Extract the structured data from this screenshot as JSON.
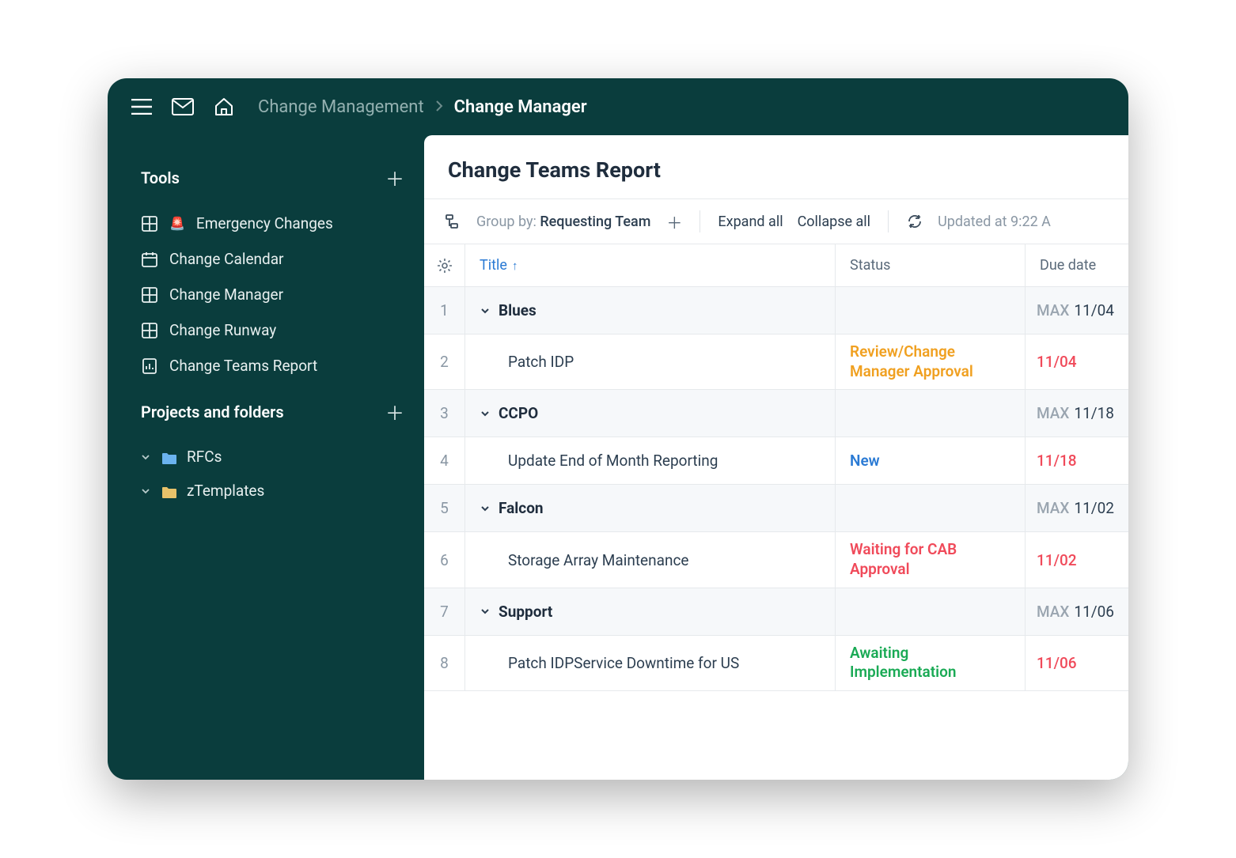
{
  "breadcrumb": {
    "parent": "Change Management",
    "current": "Change Manager"
  },
  "sidebar": {
    "sections": [
      {
        "title": "Tools",
        "items": [
          {
            "icon": "grid",
            "label": "Emergency Changes",
            "emoji": "🚨"
          },
          {
            "icon": "calendar",
            "label": "Change Calendar"
          },
          {
            "icon": "grid",
            "label": "Change Manager"
          },
          {
            "icon": "grid",
            "label": "Change Runway"
          },
          {
            "icon": "report",
            "label": "Change Teams Report"
          }
        ]
      },
      {
        "title": "Projects and folders",
        "folders": [
          {
            "label": "RFCs",
            "color": "#6bb3ef"
          },
          {
            "label": "zTemplates",
            "color": "#e8c26a"
          }
        ]
      }
    ]
  },
  "main": {
    "title": "Change Teams Report",
    "toolbar": {
      "groupby_label": "Group by:",
      "groupby_value": "Requesting Team",
      "expand": "Expand all",
      "collapse": "Collapse all",
      "updated_prefix": "Updated at",
      "updated_time": "9:22 A"
    },
    "columns": {
      "title": "Title",
      "status": "Status",
      "due": "Due date"
    },
    "rows": [
      {
        "num": 1,
        "type": "group",
        "title": "Blues",
        "due_prefix": "MAX",
        "due": "11/04"
      },
      {
        "num": 2,
        "type": "item",
        "title": "Patch IDP",
        "status": "Review/Change Manager Approval",
        "status_color": "#f0a020",
        "due": "11/04",
        "due_red": true
      },
      {
        "num": 3,
        "type": "group",
        "title": "CCPO",
        "due_prefix": "MAX",
        "due": "11/18"
      },
      {
        "num": 4,
        "type": "item",
        "title": "Update End of Month Reporting",
        "status": "New",
        "status_color": "#2a7ad4",
        "due": "11/18",
        "due_red": true
      },
      {
        "num": 5,
        "type": "group",
        "title": "Falcon",
        "due_prefix": "MAX",
        "due": "11/02"
      },
      {
        "num": 6,
        "type": "item",
        "title": "Storage Array Maintenance",
        "status": "Waiting for CAB Approval",
        "status_color": "#f04a5a",
        "due": "11/02",
        "due_red": true
      },
      {
        "num": 7,
        "type": "group",
        "title": "Support",
        "due_prefix": "MAX",
        "due": "11/06"
      },
      {
        "num": 8,
        "type": "item",
        "title": "Patch IDPService Downtime for US",
        "status": "Awaiting Implementation",
        "status_color": "#1aaa55",
        "due": "11/06",
        "due_red": true
      }
    ]
  }
}
